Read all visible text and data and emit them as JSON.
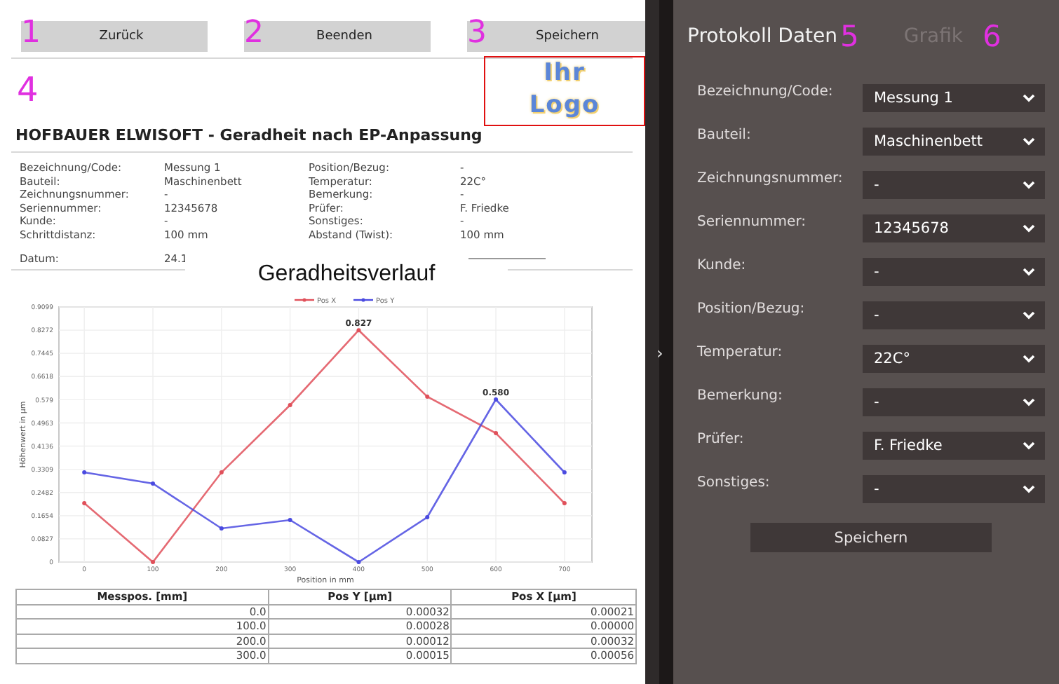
{
  "toolbar": [
    {
      "marker": "1",
      "label": "Zurück"
    },
    {
      "marker": "2",
      "label": "Beenden"
    },
    {
      "marker": "3",
      "label": "Speichern"
    }
  ],
  "report": {
    "marker": "4",
    "logo": [
      "Ihr",
      "Logo"
    ],
    "title": "HOFBAUER ELWISOFT - Geradheit nach EP-Anpassung",
    "rows": [
      {
        "left": {
          "label": "Bezeichnung/Code:",
          "value": "Messung 1"
        },
        "right": {
          "label": "Position/Bezug:",
          "value": "-"
        }
      },
      {
        "left": {
          "label": "Bauteil:",
          "value": "Maschinenbett"
        },
        "right": {
          "label": "Temperatur:",
          "value": "22C°"
        }
      },
      {
        "left": {
          "label": "Zeichnungsnummer:",
          "value": "-"
        },
        "right": {
          "label": "Bemerkung:",
          "value": "-"
        }
      },
      {
        "left": {
          "label": "Seriennummer:",
          "value": "12345678"
        },
        "right": {
          "label": "Prüfer:",
          "value": "F. Friedke"
        }
      },
      {
        "left": {
          "label": "Kunde:",
          "value": "-"
        },
        "right": {
          "label": "Sonstiges:",
          "value": "-"
        }
      },
      {
        "left": {
          "label": "Schrittdistanz:",
          "value": "100 mm"
        },
        "right": {
          "label": "Abstand (Twist):",
          "value": "100 mm"
        }
      }
    ],
    "date": {
      "label": "Datum:",
      "value": "24.1"
    },
    "chart_data": {
      "type": "line",
      "title": "Geradheitsverlauf",
      "xlabel": "Position in mm",
      "ylabel": "Höhenwert in µm",
      "x": [
        0,
        100,
        200,
        300,
        400,
        500,
        600,
        700
      ],
      "series": [
        {
          "name": "Pos X",
          "color": "#e0505a",
          "marker": true,
          "values": [
            0.21,
            0,
            0.32,
            0.56,
            0.827,
            0.59,
            0.46,
            0.21
          ]
        },
        {
          "name": "Pos Y",
          "color": "#4a4ae0",
          "marker": true,
          "values": [
            0.32,
            0.28,
            0.12,
            0.15,
            0,
            0.16,
            0.58,
            0.32
          ]
        }
      ],
      "grid": true,
      "legend": "top",
      "xlim": [
        -37,
        740
      ],
      "ylim": [
        0,
        0.9099
      ],
      "xticks": [
        0,
        100,
        200,
        300,
        400,
        500,
        600,
        700
      ],
      "yticks": [
        {
          "value": 0,
          "label": "0"
        },
        {
          "value": 0.0827,
          "label": "0.0827"
        },
        {
          "value": 0.1654,
          "label": "0.1654"
        },
        {
          "value": 0.2482,
          "label": "0.2482"
        },
        {
          "value": 0.3309,
          "label": "0.3309"
        },
        {
          "value": 0.4136,
          "label": "0.4136"
        },
        {
          "value": 0.4963,
          "label": "0.4963"
        },
        {
          "value": 0.579,
          "label": "0.579"
        },
        {
          "value": 0.6618,
          "label": "0.6618"
        },
        {
          "value": 0.7445,
          "label": "0.7445"
        },
        {
          "value": 0.8272,
          "label": "0.8272"
        },
        {
          "value": 0.9099,
          "label": "0.9099"
        }
      ],
      "annotations": [
        {
          "x": 400,
          "y": 0.827,
          "text": "0.827"
        },
        {
          "x": 600,
          "y": 0.58,
          "text": "0.580"
        }
      ]
    },
    "table": {
      "columns": [
        "Messpos. [mm]",
        "Pos Y [µm]",
        "Pos X [µm]"
      ],
      "rows": [
        [
          "0.0",
          "0.00032",
          "0.00021"
        ],
        [
          "100.0",
          "0.00028",
          "0.00000"
        ],
        [
          "200.0",
          "0.00012",
          "0.00032"
        ],
        [
          "300.0",
          "0.00015",
          "0.00056"
        ]
      ]
    }
  },
  "collapse_handle": "›",
  "panel": {
    "tabs": [
      {
        "label": "Protokoll Daten",
        "marker": "5",
        "selected": true
      },
      {
        "label": "Grafik",
        "marker": "6",
        "selected": false
      }
    ],
    "fields": [
      {
        "label": "Bezeichnung/Code:",
        "value": "Messung 1"
      },
      {
        "label": "Bauteil:",
        "value": "Maschinenbett"
      },
      {
        "label": "Zeichnungsnummer:",
        "value": "-"
      },
      {
        "label": "Seriennummer:",
        "value": "12345678"
      },
      {
        "label": "Kunde:",
        "value": "-"
      },
      {
        "label": "Position/Bezug:",
        "value": "-"
      },
      {
        "label": "Temperatur:",
        "value": "22C°"
      },
      {
        "label": "Bemerkung:",
        "value": "-"
      },
      {
        "label": "Prüfer:",
        "value": "F. Friedke"
      },
      {
        "label": "Sonstiges:",
        "value": "-"
      }
    ],
    "button": "Speichern"
  }
}
